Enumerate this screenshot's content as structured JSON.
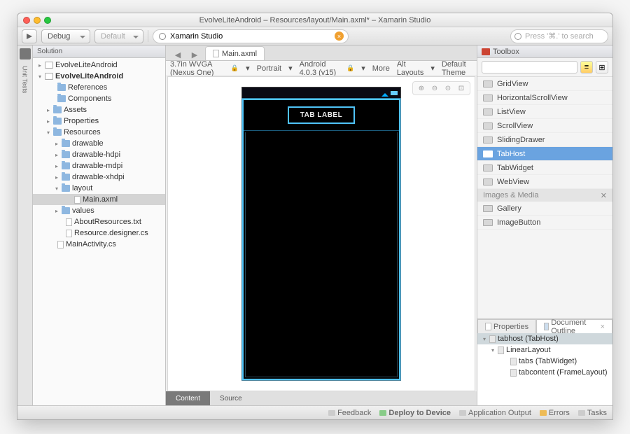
{
  "window": {
    "title": "EvolveLiteAndroid – Resources/layout/Main.axml* – Xamarin Studio"
  },
  "toolbar": {
    "config": "Debug",
    "target": "Default",
    "breadcrumb_icon": "target",
    "breadcrumb": "Xamarin Studio",
    "search_placeholder": "Press '⌘.' to search"
  },
  "leftrail": {
    "tab": "Unit Tests"
  },
  "solution": {
    "header": "Solution",
    "tree": [
      {
        "ind": 6,
        "arr": "▸",
        "ico": "proj",
        "label": "EvolveLiteAndroid"
      },
      {
        "ind": 6,
        "arr": "▾",
        "ico": "proj",
        "label": "EvolveLiteAndroid",
        "bold": true
      },
      {
        "ind": 24,
        "arr": "",
        "ico": "fld",
        "label": "References"
      },
      {
        "ind": 24,
        "arr": "",
        "ico": "fld",
        "label": "Components"
      },
      {
        "ind": 18,
        "arr": "▸",
        "ico": "fld",
        "label": "Assets"
      },
      {
        "ind": 18,
        "arr": "▸",
        "ico": "fld",
        "label": "Properties"
      },
      {
        "ind": 18,
        "arr": "▾",
        "ico": "fld",
        "label": "Resources"
      },
      {
        "ind": 30,
        "arr": "▸",
        "ico": "fld",
        "label": "drawable"
      },
      {
        "ind": 30,
        "arr": "▸",
        "ico": "fld",
        "label": "drawable-hdpi"
      },
      {
        "ind": 30,
        "arr": "▸",
        "ico": "fld",
        "label": "drawable-mdpi"
      },
      {
        "ind": 30,
        "arr": "▸",
        "ico": "fld",
        "label": "drawable-xhdpi"
      },
      {
        "ind": 30,
        "arr": "▾",
        "ico": "fld",
        "label": "layout"
      },
      {
        "ind": 48,
        "arr": "",
        "ico": "file",
        "label": "Main.axml",
        "sel": true
      },
      {
        "ind": 30,
        "arr": "▸",
        "ico": "fld",
        "label": "values"
      },
      {
        "ind": 36,
        "arr": "",
        "ico": "file",
        "label": "AboutResources.txt"
      },
      {
        "ind": 36,
        "arr": "",
        "ico": "file",
        "label": "Resource.designer.cs"
      },
      {
        "ind": 24,
        "arr": "",
        "ico": "file",
        "label": "MainActivity.cs"
      }
    ]
  },
  "editor": {
    "tab": "Main.axml",
    "designbar": {
      "device": "3.7in WVGA (Nexus One)",
      "orientation": "Portrait",
      "api": "Android 4.0.3 (v15)",
      "more": "More",
      "alt": "Alt Layouts",
      "theme": "Default Theme"
    },
    "canvas": {
      "tab_label": "TAB LABEL"
    },
    "bottom_tabs": {
      "content": "Content",
      "source": "Source"
    }
  },
  "toolbox": {
    "header": "Toolbox",
    "items": [
      "GridView",
      "HorizontalScrollView",
      "ListView",
      "ScrollView",
      "SlidingDrawer",
      "TabHost",
      "TabWidget",
      "WebView"
    ],
    "selected": 5,
    "cat2": "Images & Media",
    "items2": [
      "Gallery",
      "ImageButton"
    ]
  },
  "right_bottom": {
    "tabs": {
      "props": "Properties",
      "outline": "Document Outline"
    },
    "outline": [
      {
        "ind": 6,
        "arr": "▾",
        "label": "tabhost (TabHost)",
        "root": true
      },
      {
        "ind": 18,
        "arr": "▾",
        "label": "LinearLayout"
      },
      {
        "ind": 36,
        "arr": "",
        "label": "tabs (TabWidget)"
      },
      {
        "ind": 36,
        "arr": "",
        "label": "tabcontent (FrameLayout)"
      }
    ]
  },
  "status": {
    "feedback": "Feedback",
    "deploy": "Deploy to Device",
    "output": "Application Output",
    "errors": "Errors",
    "tasks": "Tasks"
  }
}
